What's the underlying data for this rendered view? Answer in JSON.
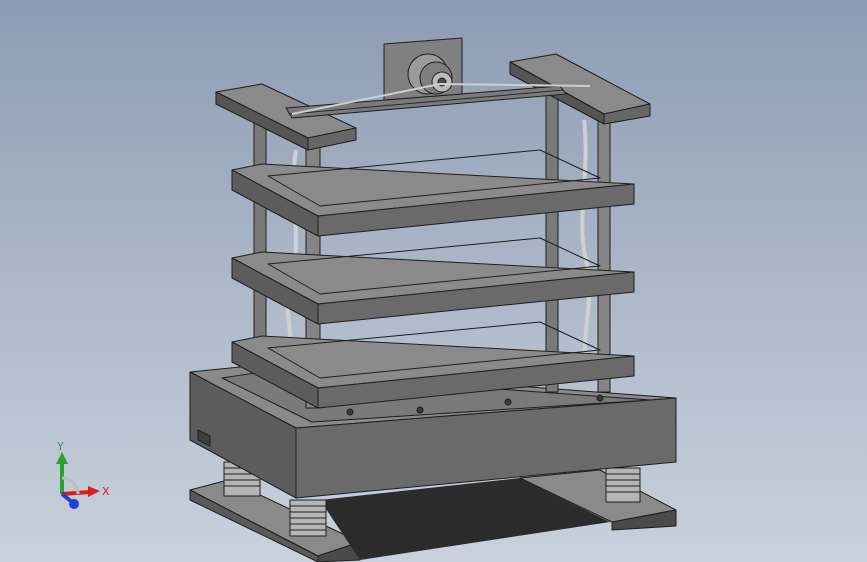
{
  "viewport": {
    "background_top": "#8d9cb3",
    "background_bottom": "#c9d1dc"
  },
  "model": {
    "face_color": "#6e6e6e",
    "face_light": "#8a8a8a",
    "face_dark": "#4a4a4a",
    "edge_color": "#1e1e1e",
    "spring_color": "#b5b5b5"
  },
  "triad": {
    "x_label": "X",
    "y_label": "Y",
    "x_color": "#d81e1e",
    "y_color": "#2ca02c",
    "z_color": "#1f3fd8"
  }
}
